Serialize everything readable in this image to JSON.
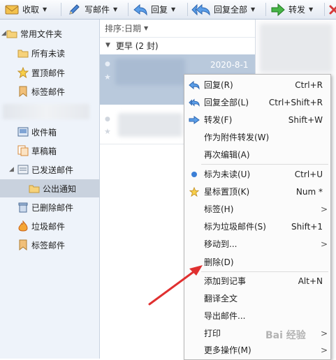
{
  "toolbar": {
    "receive": "收取",
    "compose": "写邮件",
    "reply": "回复",
    "reply_all": "回复全部",
    "forward": "转发"
  },
  "sidebar": {
    "common_folders": "常用文件夹",
    "unread": "所有未读",
    "pinned": "置顶邮件",
    "tagged": "标签邮件",
    "inbox": "收件箱",
    "drafts": "草稿箱",
    "sent": "已发送邮件",
    "sent_sub": "公出通知",
    "deleted": "已删除邮件",
    "junk": "垃圾邮件",
    "tagged2": "标签邮件"
  },
  "list": {
    "sort_label": "排序:日期",
    "group_label": "更早 (2 封)",
    "selected_date": "2020-8-1"
  },
  "menu": {
    "items": [
      {
        "label": "回复(R)",
        "shortcut": "Ctrl+R"
      },
      {
        "label": "回复全部(L)",
        "shortcut": "Ctrl+Shift+R"
      },
      {
        "label": "转发(F)",
        "shortcut": "Shift+W"
      },
      {
        "label": "作为附件转发(W)",
        "shortcut": ""
      },
      {
        "label": "再次编辑(A)",
        "shortcut": ""
      },
      {
        "label": "标为未读(U)",
        "shortcut": "Ctrl+U"
      },
      {
        "label": "星标置顶(K)",
        "shortcut": "Num *"
      },
      {
        "label": "标签(H)",
        "shortcut": ""
      },
      {
        "label": "标为垃圾邮件(S)",
        "shortcut": "Shift+1"
      },
      {
        "label": "移动到...",
        "shortcut": ""
      },
      {
        "label": "删除(D)",
        "shortcut": ""
      },
      {
        "label": "添加到记事",
        "shortcut": "Alt+N"
      },
      {
        "label": "翻译全文",
        "shortcut": ""
      },
      {
        "label": "导出邮件...",
        "shortcut": ""
      },
      {
        "label": "打印",
        "shortcut": ""
      },
      {
        "label": "更多操作(M)",
        "shortcut": ""
      }
    ]
  },
  "watermark": "Bai 经验",
  "colors": {
    "toolbar_bg": "#e3e9f2",
    "sidebar_bg": "#eef3fa",
    "selected_row": "#b9c9dc",
    "arrow_annotation": "#e03030"
  }
}
